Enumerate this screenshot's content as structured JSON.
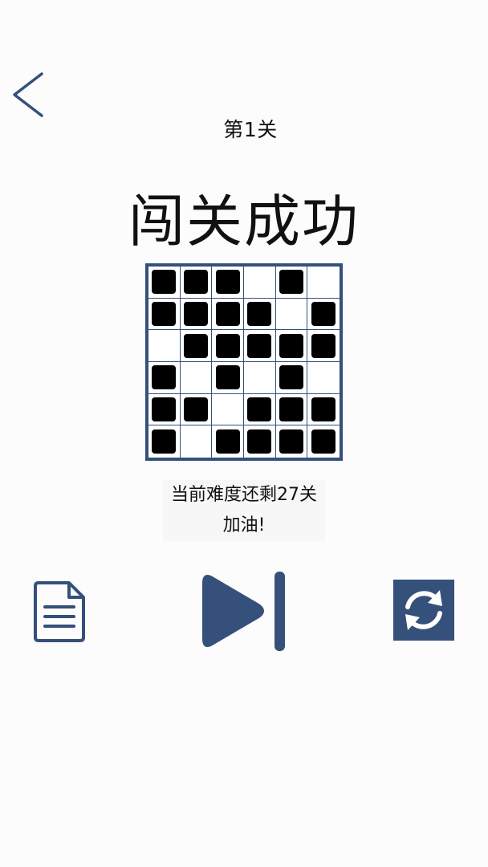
{
  "header": {
    "back_icon": "chevron-left-icon",
    "level_label": "第1关"
  },
  "result": {
    "title": "闯关成功"
  },
  "board": {
    "size": 6,
    "cells": [
      [
        1,
        1,
        1,
        0,
        1,
        0
      ],
      [
        1,
        1,
        1,
        1,
        0,
        1
      ],
      [
        0,
        1,
        1,
        1,
        1,
        1
      ],
      [
        1,
        0,
        1,
        0,
        1,
        0
      ],
      [
        1,
        1,
        0,
        1,
        1,
        1
      ],
      [
        1,
        0,
        1,
        1,
        1,
        1
      ]
    ]
  },
  "message": {
    "remaining": "当前难度还剩27关",
    "cheer": "加油!"
  },
  "controls": {
    "doc_icon": "document-icon",
    "next_icon": "skip-next-icon",
    "refresh_icon": "refresh-icon"
  },
  "colors": {
    "accent": "#35507a",
    "piece": "#000000",
    "background": "#fcfcfd"
  }
}
